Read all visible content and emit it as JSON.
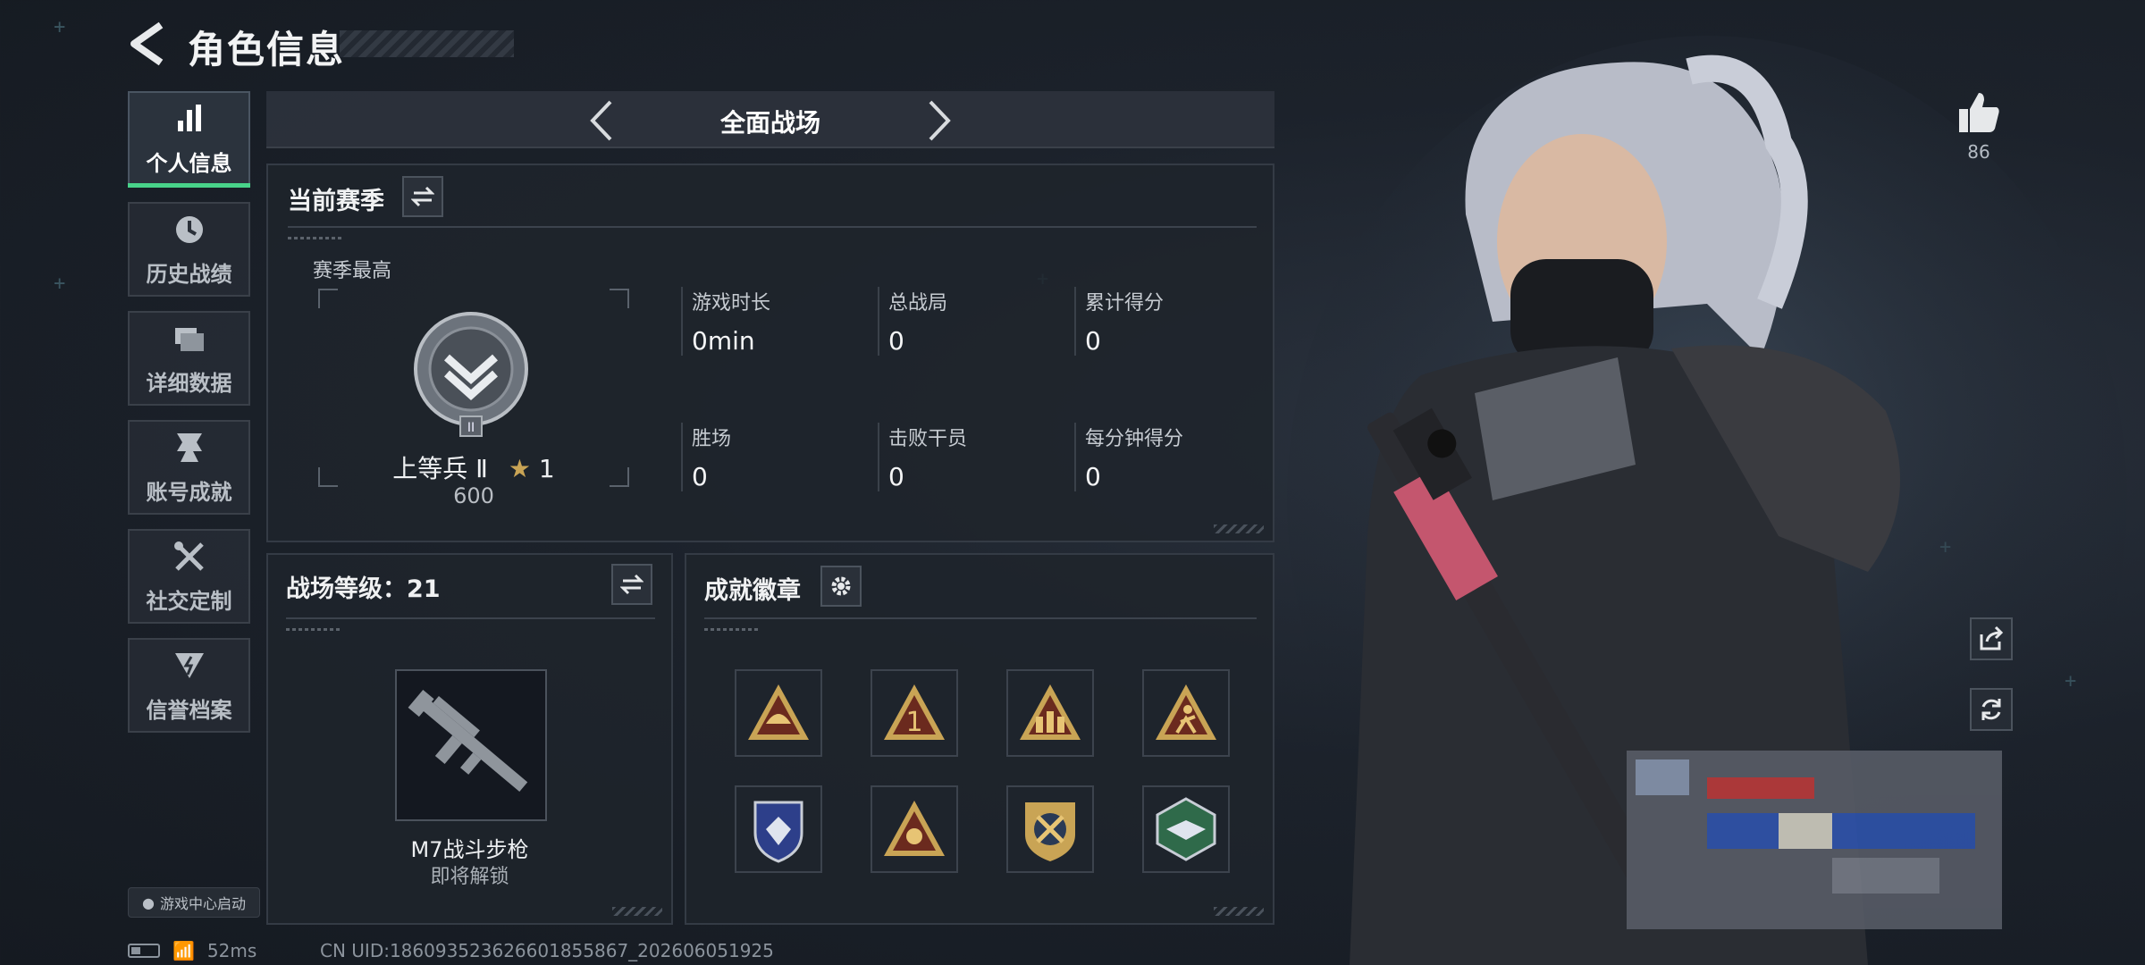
{
  "header": {
    "title": "角色信息"
  },
  "sidebar": {
    "items": [
      {
        "label": "个人信息",
        "icon": "bar-chart-icon",
        "active": true
      },
      {
        "label": "历史战绩",
        "icon": "history-icon",
        "active": false
      },
      {
        "label": "详细数据",
        "icon": "folder-icon",
        "active": false
      },
      {
        "label": "账号成就",
        "icon": "achievement-icon",
        "active": false
      },
      {
        "label": "社交定制",
        "icon": "tools-icon",
        "active": false
      },
      {
        "label": "信誉档案",
        "icon": "credit-icon",
        "active": false
      }
    ],
    "launch_label": "游戏中心启动"
  },
  "mode": {
    "title": "全面战场"
  },
  "season": {
    "title": "当前赛季",
    "best_label": "赛季最高",
    "rank_name": "上等兵 Ⅱ",
    "rank_stars": "1",
    "rank_points": "600",
    "stats": [
      {
        "label": "游戏时长",
        "value": "0min"
      },
      {
        "label": "总战局",
        "value": "0"
      },
      {
        "label": "累计得分",
        "value": "0"
      },
      {
        "label": "胜场",
        "value": "0"
      },
      {
        "label": "击败干员",
        "value": "0"
      },
      {
        "label": "每分钟得分",
        "value": "0"
      }
    ]
  },
  "level": {
    "title": "战场等级：21",
    "weapon_name": "M7战斗步枪",
    "weapon_status": "即将解锁"
  },
  "badges": {
    "title": "成就徽章",
    "items": [
      "badge-helmet-icon",
      "badge-rank-one-icon",
      "badge-soldiers-icon",
      "badge-runner-icon",
      "badge-shield-icon",
      "badge-emblem-icon",
      "badge-crossed-guns-icon",
      "badge-eagle-icon"
    ]
  },
  "footer": {
    "ping": "52ms",
    "uid": "CN UID:186093523626601855867_202606051925"
  },
  "profile": {
    "likes": "86"
  },
  "colors": {
    "accent": "#48d38a",
    "gold": "#c9a455"
  }
}
